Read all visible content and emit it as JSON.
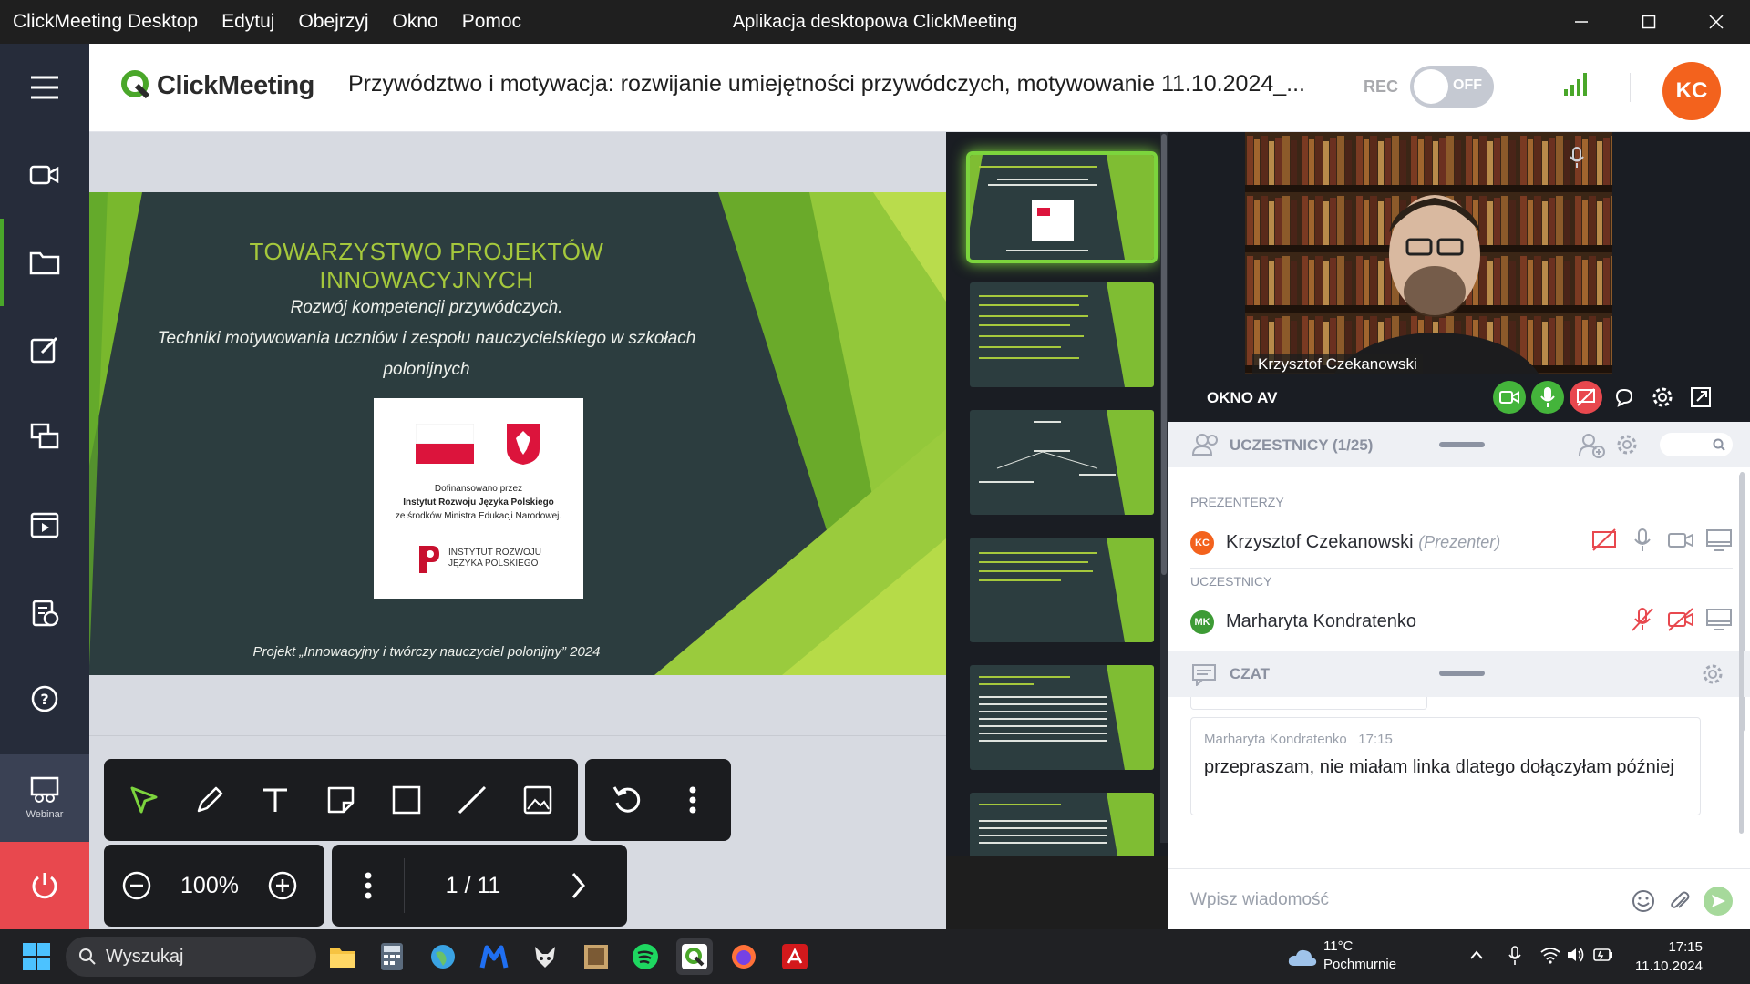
{
  "titlebar": {
    "menu": [
      "ClickMeeting Desktop",
      "Edytuj",
      "Obejrzyj",
      "Okno",
      "Pomoc"
    ],
    "window_title": "Aplikacja desktopowa ClickMeeting"
  },
  "sidebar": {
    "items": [
      {
        "icon": "menu-icon"
      },
      {
        "icon": "camera-icon"
      },
      {
        "icon": "folder-icon"
      },
      {
        "icon": "edit-icon"
      },
      {
        "icon": "screen-share-icon"
      },
      {
        "icon": "video-player-icon"
      },
      {
        "icon": "survey-icon"
      },
      {
        "icon": "help-chat-icon"
      },
      {
        "icon": "webinar-icon",
        "label": "Webinar"
      }
    ],
    "power_icon": "power-icon"
  },
  "header": {
    "logo_text": "ClickMeeting",
    "meeting_title": "Przywództwo i motywacja: rozwijanie umiejętności przywódczych, motywowanie 11.10.2024_...",
    "rec_label": "REC",
    "rec_state": "OFF",
    "avatar_initials": "KC"
  },
  "slide": {
    "title": "TOWARZYSTWO PROJEKTÓW INNOWACYJNYCH",
    "subtitle_line1": "Rozwój kompetencji przywódczych.",
    "subtitle_line2": "Techniki motywowania uczniów i zespołu nauczycielskiego w szkołach polonijnych",
    "logo_line1": "Dofinansowano przez",
    "logo_line2": "Instytut Rozwoju Języka Polskiego",
    "logo_line3": "ze środków Ministra Edukacji Narodowej.",
    "logo_brand1": "INSTYTUT ROZWOJU",
    "logo_brand2": "JĘZYKA POLSKIEGO",
    "footer": "Projekt „Innowacyjny i twórczy nauczyciel polonijny” 2024"
  },
  "toolbar": {
    "zoom": "100%",
    "page": "1 / 11"
  },
  "av": {
    "title": "OKNO AV",
    "speaker_name": "Krzysztof Czekanowski"
  },
  "participants": {
    "header": "UCZESTNICY (1/25)",
    "presenters_label": "PREZENTERZY",
    "attendees_label": "UCZESTNICY",
    "presenter": {
      "initials": "KC",
      "name": "Krzysztof Czekanowski",
      "role": "(Prezenter)"
    },
    "attendee": {
      "initials": "MK",
      "name": "Marharyta Kondratenko"
    }
  },
  "chat": {
    "header": "CZAT",
    "message": {
      "author": "Marharyta Kondratenko",
      "time": "17:15",
      "text": "przepraszam, nie miałam linka dlatego dołączyłam później"
    },
    "input_placeholder": "Wpisz wiadomość"
  },
  "taskbar": {
    "search_label": "Wyszukaj",
    "weather_temp": "11°C",
    "weather_cond": "Pochmurnie",
    "time": "17:15",
    "date": "11.10.2024"
  },
  "colors": {
    "accent_green": "#4aa72a",
    "brand_orange": "#f3621d",
    "sidebar_bg": "#262c3a",
    "power_red": "#e8484e"
  }
}
